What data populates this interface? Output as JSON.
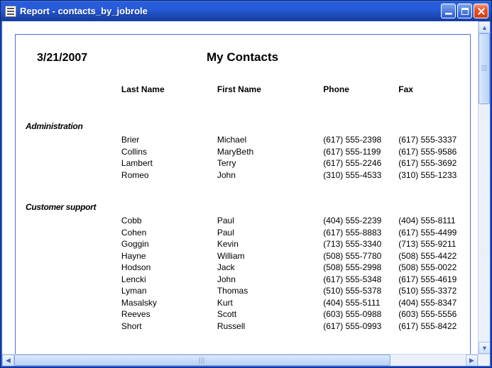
{
  "window": {
    "title": "Report - contacts_by_jobrole"
  },
  "report": {
    "date": "3/21/2007",
    "title": "My Contacts",
    "columns": {
      "last": "Last Name",
      "first": "First Name",
      "phone": "Phone",
      "fax": "Fax"
    },
    "groups": [
      {
        "name": "Administration",
        "rows": [
          {
            "last": "Brier",
            "first": "Michael",
            "phone": "(617) 555-2398",
            "fax": "(617) 555-3337"
          },
          {
            "last": "Collins",
            "first": "MaryBeth",
            "phone": "(617) 555-1199",
            "fax": "(617) 555-9586"
          },
          {
            "last": "Lambert",
            "first": "Terry",
            "phone": "(617) 555-2246",
            "fax": "(617) 555-3692"
          },
          {
            "last": "Romeo",
            "first": "John",
            "phone": "(310) 555-4533",
            "fax": "(310) 555-1233"
          }
        ]
      },
      {
        "name": "Customer support",
        "rows": [
          {
            "last": "Cobb",
            "first": "Paul",
            "phone": "(404) 555-2239",
            "fax": "(404) 555-8111"
          },
          {
            "last": "Cohen",
            "first": "Paul",
            "phone": "(617) 555-8883",
            "fax": "(617) 555-4499"
          },
          {
            "last": "Goggin",
            "first": "Kevin",
            "phone": "(713) 555-3340",
            "fax": "(713) 555-9211"
          },
          {
            "last": "Hayne",
            "first": "William",
            "phone": "(508) 555-7780",
            "fax": "(508) 555-4422"
          },
          {
            "last": "Hodson",
            "first": "Jack",
            "phone": "(508) 555-2998",
            "fax": "(508) 555-0022"
          },
          {
            "last": "Lencki",
            "first": "John",
            "phone": "(617) 555-5348",
            "fax": "(617) 555-4619"
          },
          {
            "last": "Lyman",
            "first": "Thomas",
            "phone": "(510) 555-5378",
            "fax": "(510) 555-3372"
          },
          {
            "last": "Masalsky",
            "first": "Kurt",
            "phone": "(404) 555-5111",
            "fax": "(404) 555-8347"
          },
          {
            "last": "Reeves",
            "first": "Scott",
            "phone": "(603) 555-0988",
            "fax": "(603) 555-5556"
          },
          {
            "last": "Short",
            "first": "Russell",
            "phone": "(617) 555-0993",
            "fax": "(617) 555-8422"
          }
        ]
      }
    ]
  }
}
